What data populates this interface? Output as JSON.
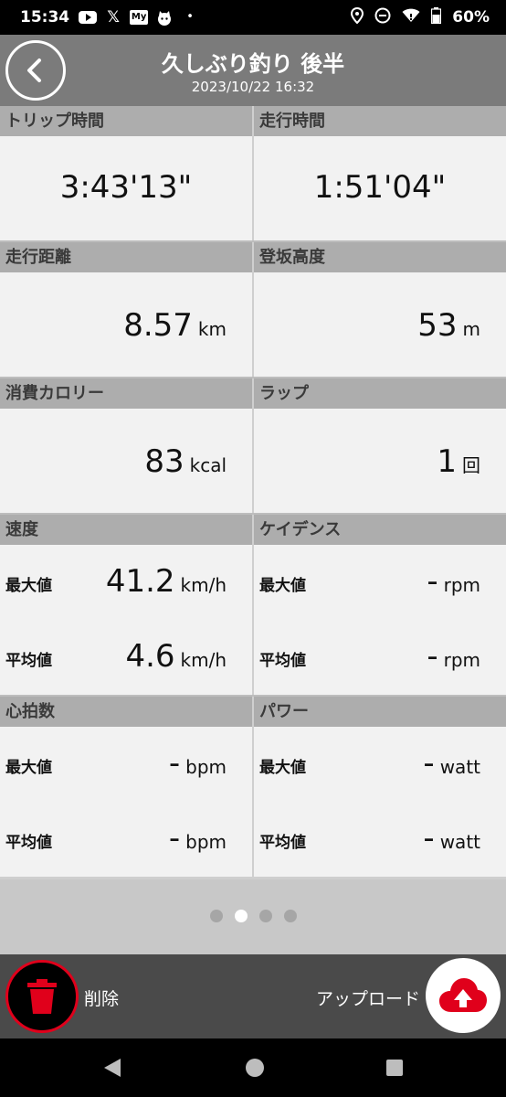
{
  "status_bar": {
    "time": "15:34",
    "icons": [
      "youtube-icon",
      "x-icon",
      "my-icon",
      "cat-app-icon",
      "dot-icon",
      "location-icon",
      "dnd-icon",
      "wifi-icon",
      "battery-icon"
    ],
    "my_label": "My",
    "battery": "60%"
  },
  "header": {
    "title": "久しぶり釣り 後半",
    "datetime": "2023/10/22 16:32"
  },
  "stats": {
    "trip_time": {
      "label": "トリップ時間",
      "value": "3:43'13\""
    },
    "ride_time": {
      "label": "走行時間",
      "value": "1:51'04\""
    },
    "distance": {
      "label": "走行距離",
      "value": "8.57",
      "unit": "km"
    },
    "climb": {
      "label": "登坂高度",
      "value": "53",
      "unit": "m"
    },
    "calories": {
      "label": "消費カロリー",
      "value": "83",
      "unit": "kcal"
    },
    "laps": {
      "label": "ラップ",
      "value": "1",
      "unit": "回"
    },
    "speed": {
      "label": "速度",
      "max_label": "最大値",
      "max_value": "41.2",
      "max_unit": "km/h",
      "avg_label": "平均値",
      "avg_value": "4.6",
      "avg_unit": "km/h"
    },
    "cadence": {
      "label": "ケイデンス",
      "max_label": "最大値",
      "max_value": "-",
      "max_unit": "rpm",
      "avg_label": "平均値",
      "avg_value": "-",
      "avg_unit": "rpm"
    },
    "heart_rate": {
      "label": "心拍数",
      "max_label": "最大値",
      "max_value": "-",
      "max_unit": "bpm",
      "avg_label": "平均値",
      "avg_value": "-",
      "avg_unit": "bpm"
    },
    "power": {
      "label": "パワー",
      "max_label": "最大値",
      "max_value": "-",
      "max_unit": "watt",
      "avg_label": "平均値",
      "avg_value": "-",
      "avg_unit": "watt"
    }
  },
  "pager": {
    "pages": 4,
    "active_page": 2
  },
  "actions": {
    "delete_label": "削除",
    "upload_label": "アップロード"
  },
  "colors": {
    "header_bg": "#7b7b7b",
    "cell_head_bg": "#adadad",
    "cell_bg": "#f2f2f2",
    "bottom_bar_bg": "#4a4a4a",
    "accent_red": "#e0001b"
  }
}
